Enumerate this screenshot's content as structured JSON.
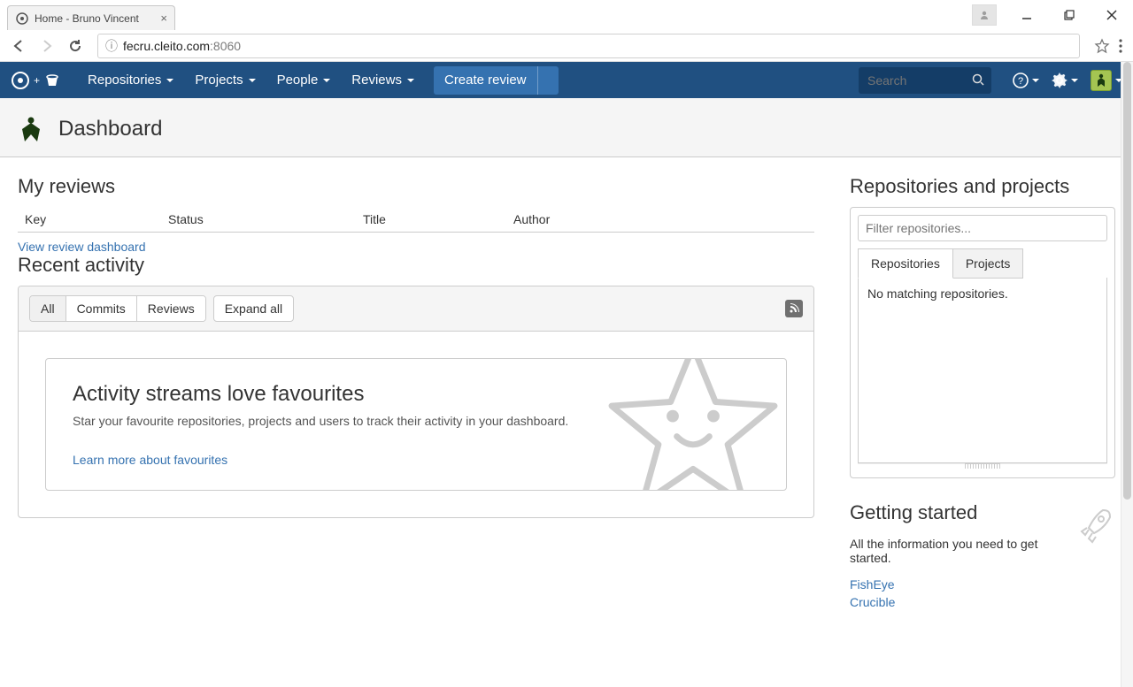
{
  "browser": {
    "tab_title": "Home - Bruno Vincent",
    "url_prefix": "ⓘ ",
    "url_domain": "fecru.cleito.com",
    "url_port": ":8060"
  },
  "topnav": {
    "items": [
      "Repositories",
      "Projects",
      "People",
      "Reviews"
    ],
    "create_label": "Create review",
    "search_placeholder": "Search"
  },
  "page_title": "Dashboard",
  "reviews": {
    "heading": "My reviews",
    "columns": {
      "key": "Key",
      "status": "Status",
      "title": "Title",
      "author": "Author"
    },
    "dashboard_link": "View review dashboard"
  },
  "activity": {
    "heading": "Recent activity",
    "filters": {
      "all": "All",
      "commits": "Commits",
      "reviews": "Reviews"
    },
    "expand": "Expand all",
    "fav": {
      "title": "Activity streams love favourites",
      "text": "Star your favourite repositories, projects and users to track their activity in your dashboard.",
      "learn": "Learn more about favourites"
    }
  },
  "side": {
    "heading": "Repositories and projects",
    "filter_placeholder": "Filter repositories...",
    "tabs": {
      "repos": "Repositories",
      "projects": "Projects"
    },
    "empty": "No matching repositories."
  },
  "getting": {
    "heading": "Getting started",
    "text": "All the information you need to get started.",
    "links": {
      "fisheye": "FishEye",
      "crucible": "Crucible"
    }
  }
}
